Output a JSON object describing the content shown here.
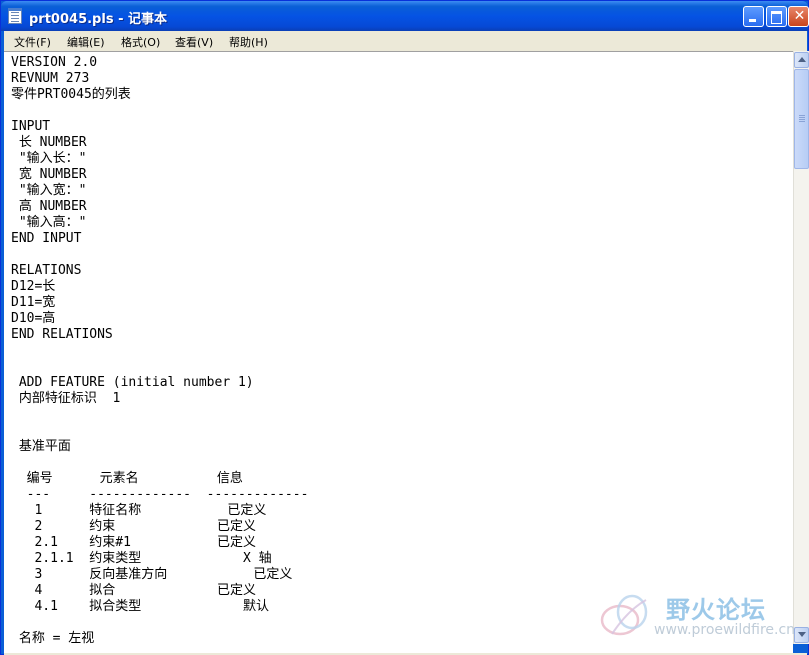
{
  "window": {
    "title": "prt0045.pls - 记事本"
  },
  "menu": [
    {
      "label": "文件(F)"
    },
    {
      "label": "编辑(E)"
    },
    {
      "label": "格式(O)"
    },
    {
      "label": "查看(V)"
    },
    {
      "label": "帮助(H)"
    }
  ],
  "editor": {
    "lines": [
      "VERSION 2.0",
      "REVNUM 273",
      "零件PRT0045的列表",
      "",
      "INPUT",
      " 长 NUMBER",
      " \"输入长：\"",
      " 宽 NUMBER",
      " \"输入宽：\"",
      " 高 NUMBER",
      " \"输入高：\"",
      "END INPUT",
      "",
      "RELATIONS",
      "D12=长",
      "D11=宽",
      "D10=高",
      "END RELATIONS",
      "",
      "",
      " ADD FEATURE (initial number 1)",
      " 内部特征标识  1",
      "",
      "",
      " 基准平面",
      "",
      "  编号      元素名          信息",
      "  ---     -------------  -------------",
      "   1      特征名称           已定义",
      "   2      约束             已定义",
      "   2.1    约束#1           已定义",
      "   2.1.1  约束类型             X 轴",
      "   3      反向基准方向           已定义",
      "   4      拟合             已定义",
      "   4.1    拟合类型             默认",
      "",
      " 名称 = 左视"
    ]
  },
  "watermark": {
    "title": "野火论坛",
    "url": "www.proewildfire.cn"
  },
  "colors": {
    "titlebar": "#0553e4",
    "menubar": "#ece9d8",
    "close_button": "#c9441d"
  }
}
